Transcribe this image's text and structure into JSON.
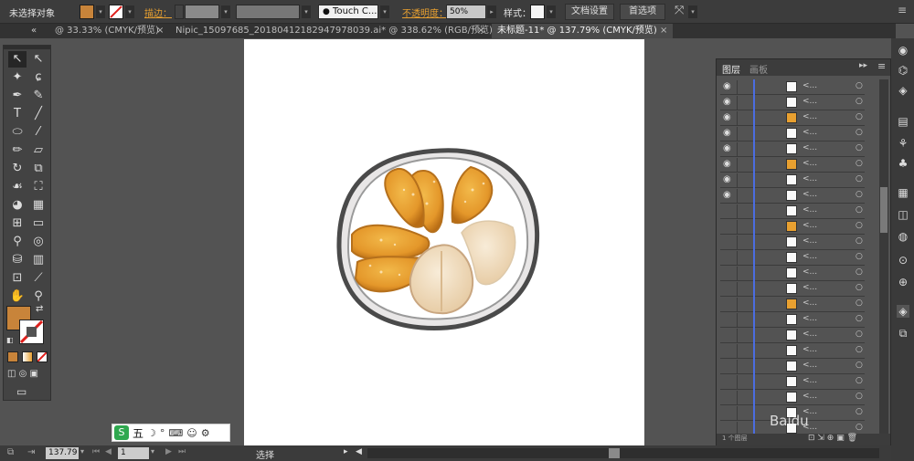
{
  "control_bar": {
    "selection_label": "未选择对象",
    "stroke_label": "描边：",
    "brush_label": "Touch C...",
    "opacity_label": "不透明度：",
    "opacity_value": "50%",
    "style_label": "样式：",
    "doc_setup": "文档设置",
    "preferences": "首选项",
    "fill_color": "#c8843a"
  },
  "tabs": {
    "collapse": "«",
    "tab1": "@ 33.33% (CMYK/预览)",
    "tab2": "Nipic_15097685_20180412182947978039.ai* @ 338.62% (RGB/预览)",
    "tab3": "未标题-11* @ 137.79% (CMYK/预览)",
    "close": "×"
  },
  "tools": {
    "items": [
      "selection-tool",
      "direct-selection-tool",
      "magic-wand-tool",
      "lasso-tool",
      "pen-tool",
      "curvature-tool",
      "type-tool",
      "line-tool",
      "ellipse-tool",
      "paintbrush-tool",
      "pencil-tool",
      "eraser-tool",
      "rotate-tool",
      "scale-tool",
      "warp-tool",
      "free-transform-tool",
      "shape-builder-tool",
      "graph-tool",
      "mesh-tool",
      "gradient-tool",
      "eyedropper-tool",
      "blend-tool",
      "symbol-sprayer-tool",
      "column-graph-tool",
      "artboard-tool",
      "slice-tool",
      "hand-tool",
      "zoom-tool"
    ],
    "fill_color": "#c8843a"
  },
  "layers_panel": {
    "tab_layers": "图层",
    "tab_artboards": "画板",
    "row_label": "<...",
    "footer": "1 个图层"
  },
  "status": {
    "zoom": "137.79",
    "artboard": "1",
    "tool_label": "选择"
  },
  "ime": {
    "label": "五"
  },
  "watermark": {
    "text": "Baidu"
  }
}
